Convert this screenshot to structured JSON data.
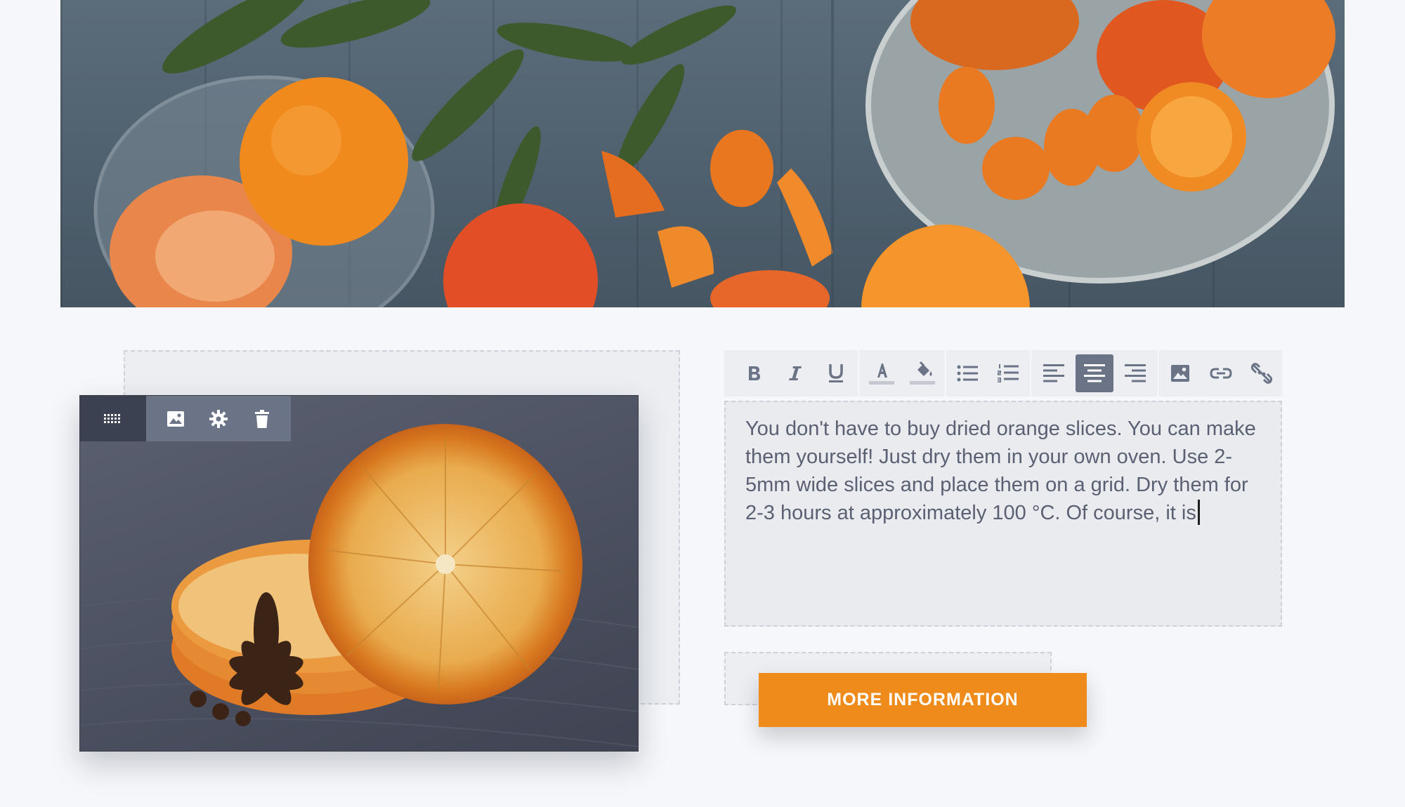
{
  "hero": {
    "image_alt": "Oranges, persimmons and peppers on a wooden table"
  },
  "image_module": {
    "image_alt": "Dried orange slices with star anise",
    "toolbar": {
      "handle_icon": "drag-handle-icon",
      "buttons": [
        {
          "icon": "image-icon"
        },
        {
          "icon": "gear-icon"
        },
        {
          "icon": "trash-icon"
        }
      ]
    }
  },
  "editor": {
    "toolbar": {
      "groups": [
        [
          {
            "icon": "bold-icon"
          },
          {
            "icon": "italic-icon"
          },
          {
            "icon": "underline-icon"
          }
        ],
        [
          {
            "icon": "text-color-icon"
          },
          {
            "icon": "fill-color-icon"
          }
        ],
        [
          {
            "icon": "bulleted-list-icon"
          },
          {
            "icon": "numbered-list-icon"
          }
        ],
        [
          {
            "icon": "align-left-icon"
          },
          {
            "icon": "align-center-icon",
            "active": true
          },
          {
            "icon": "align-right-icon"
          }
        ],
        [
          {
            "icon": "insert-image-icon"
          },
          {
            "icon": "link-icon"
          },
          {
            "icon": "unlink-icon"
          }
        ]
      ]
    },
    "content": "You don't have to buy dried orange slices. You can make them yourself! Just dry them in your own oven. Use 2-5mm wide slices and place them on a grid. Dry them for 2-3 hours at approximately 100 °C. Of course, it is"
  },
  "cta": {
    "label": "MORE INFORMATION"
  },
  "colors": {
    "accent": "#ee8b1a",
    "toolbar_active": "#6b7386",
    "text": "#5b6073",
    "background": "#f6f7fa"
  }
}
